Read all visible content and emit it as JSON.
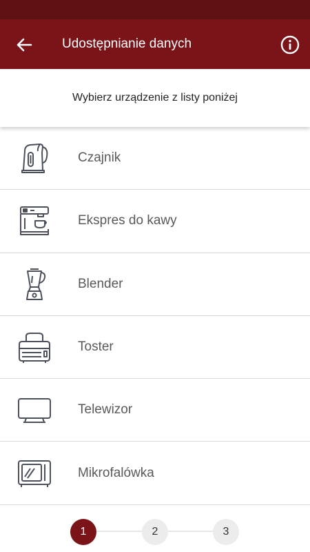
{
  "header": {
    "title": "Udostępnianie danych"
  },
  "prompt": "Wybierz urządzenie z listy poniżej",
  "devices": [
    {
      "label": "Czajnik",
      "icon": "kettle-icon"
    },
    {
      "label": "Ekspres do kawy",
      "icon": "coffee-machine-icon"
    },
    {
      "label": "Blender",
      "icon": "blender-icon"
    },
    {
      "label": "Toster",
      "icon": "toaster-icon"
    },
    {
      "label": "Telewizor",
      "icon": "tv-icon"
    },
    {
      "label": "Mikrofalówka",
      "icon": "microwave-icon"
    }
  ],
  "stepper": {
    "steps": [
      "1",
      "2",
      "3"
    ],
    "active_index": 0
  },
  "colors": {
    "primary": "#7a1418",
    "status_bar": "#5e1214",
    "icon_stroke": "#4a4f5a",
    "label_text": "#595959"
  }
}
